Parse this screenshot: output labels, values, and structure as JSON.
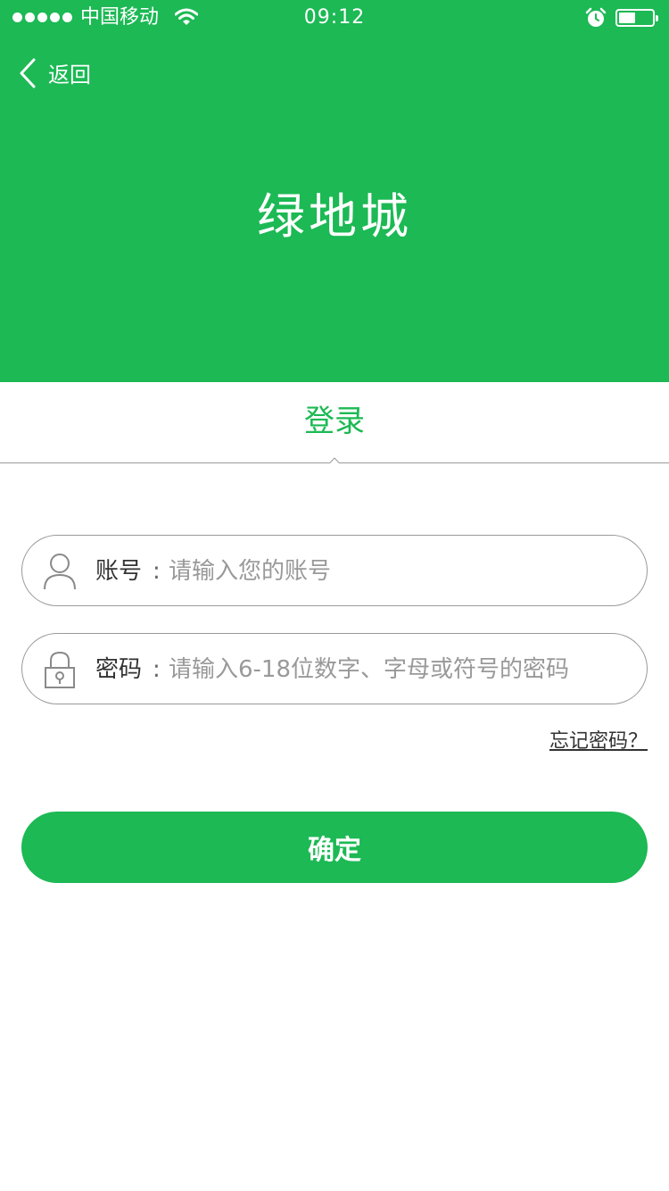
{
  "status_bar": {
    "carrier": "中国移动",
    "time": "09:12",
    "battery_level": 0.5,
    "signal_bars": 5
  },
  "nav": {
    "back_label": "返回",
    "back_icon": "chevron-left-icon"
  },
  "brand": {
    "logo_text": "绿地城"
  },
  "tabs": {
    "active_label": "登录"
  },
  "form": {
    "account": {
      "label": "账号",
      "colon": ":",
      "placeholder": "请输入您的账号",
      "icon": "user-icon"
    },
    "password": {
      "label": "密码",
      "colon": ":",
      "placeholder": "请输入6-18位数字、字母或符号的密码",
      "icon": "lock-icon"
    },
    "forgot_label": "忘记密码？",
    "submit_label": "确定"
  },
  "colors": {
    "accent": "#1cb954",
    "border": "#9a9a9a",
    "placeholder": "#999999"
  }
}
